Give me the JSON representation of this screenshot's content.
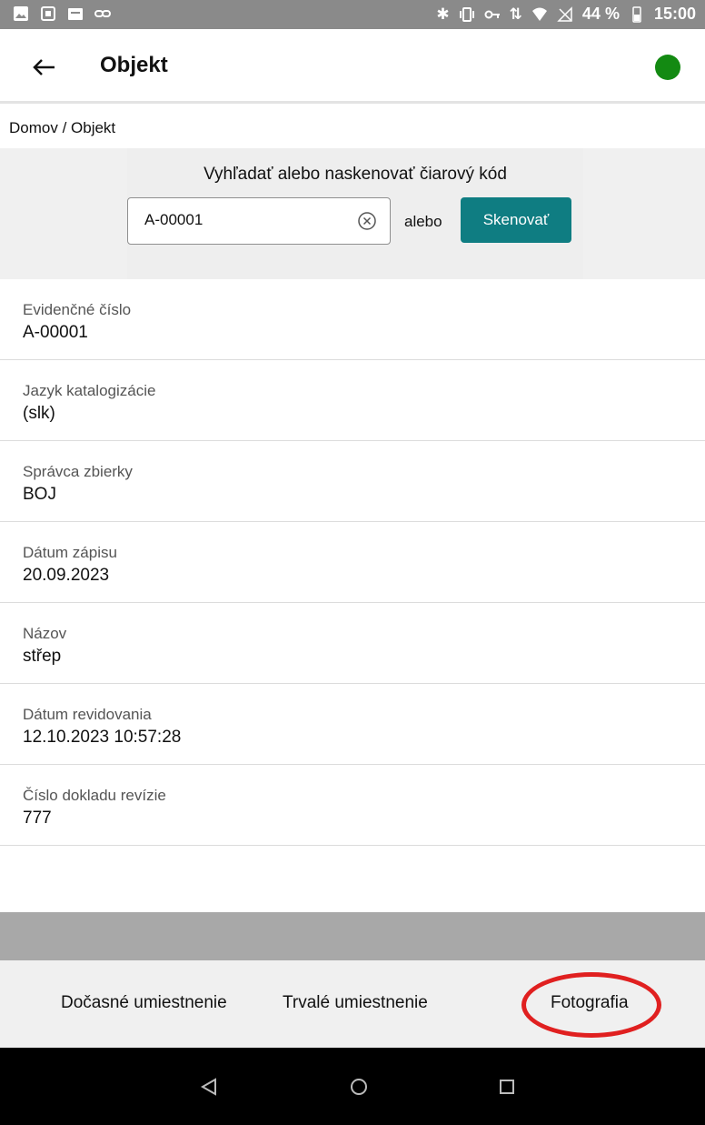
{
  "status_bar": {
    "battery_percent": "44 %",
    "time": "15:00",
    "left_icons": [
      "image-icon",
      "screenshot-icon",
      "store-icon",
      "link-icon"
    ],
    "right_icons": [
      "bluetooth-icon",
      "vibrate-icon",
      "vpn-key-icon",
      "data-arrows-icon",
      "wifi-icon",
      "no-signal-icon",
      "battery-icon"
    ]
  },
  "app_bar": {
    "title": "Objekt",
    "status_color": "#138a12"
  },
  "breadcrumb": "Domov / Objekt",
  "search": {
    "title": "Vyhľadať alebo naskenovať čiarový kód",
    "value": "A-00001",
    "or_label": "alebo",
    "scan_label": "Skenovať"
  },
  "fields": [
    {
      "label": "Evidenčné číslo",
      "value": "A-00001"
    },
    {
      "label": "Jazyk katalogizácie",
      "value": "(slk)"
    },
    {
      "label": "Správca zbierky",
      "value": "BOJ"
    },
    {
      "label": "Dátum zápisu",
      "value": "20.09.2023"
    },
    {
      "label": "Názov",
      "value": "střep"
    },
    {
      "label": "Dátum revidovania",
      "value": "12.10.2023 10:57:28"
    },
    {
      "label": "Číslo dokladu revízie",
      "value": "777"
    }
  ],
  "bottom_tabs": [
    {
      "label": "Dočasné umiestnenie"
    },
    {
      "label": "Trvalé umiestnenie"
    },
    {
      "label": "Fotografia"
    }
  ],
  "colors": {
    "accent": "#0f7d82",
    "highlight": "#e02020"
  }
}
